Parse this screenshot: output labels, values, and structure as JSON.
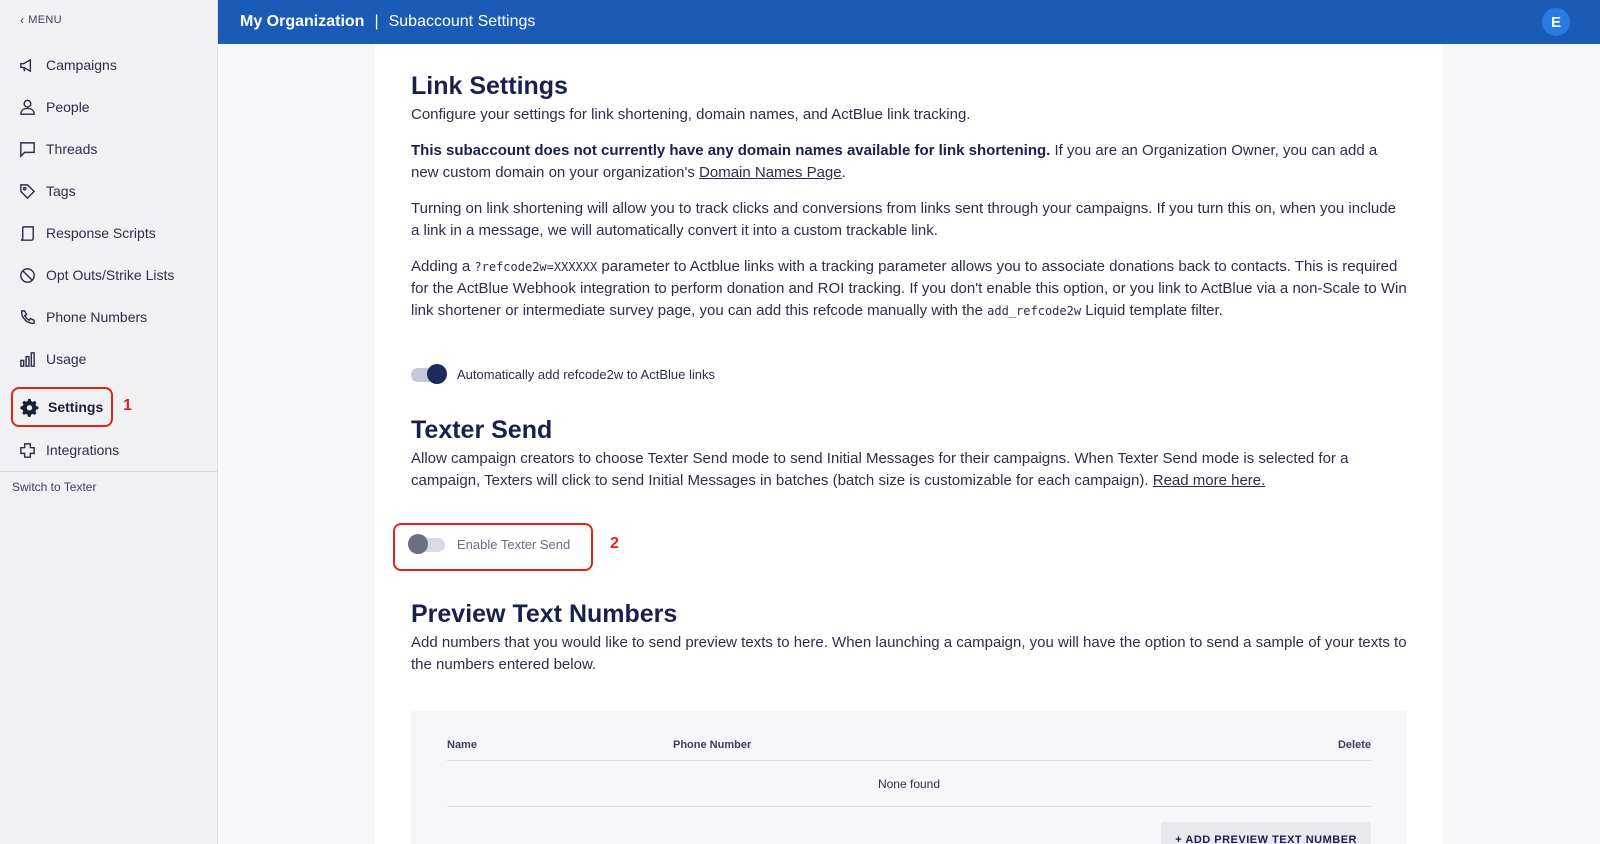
{
  "sidebar": {
    "menu_back": "MENU",
    "items": [
      {
        "label": "Campaigns",
        "icon": "megaphone-icon"
      },
      {
        "label": "People",
        "icon": "person-icon"
      },
      {
        "label": "Threads",
        "icon": "chat-icon"
      },
      {
        "label": "Tags",
        "icon": "tag-icon"
      },
      {
        "label": "Response Scripts",
        "icon": "script-icon"
      },
      {
        "label": "Opt Outs/Strike Lists",
        "icon": "block-icon"
      },
      {
        "label": "Phone Numbers",
        "icon": "phone-icon"
      },
      {
        "label": "Usage",
        "icon": "bar-chart-icon"
      },
      {
        "label": "Settings",
        "icon": "gear-icon",
        "active": true
      },
      {
        "label": "Integrations",
        "icon": "puzzle-icon"
      }
    ],
    "switch_to_texter": "Switch to Texter"
  },
  "annotations": {
    "marker_1": "1",
    "marker_2": "2",
    "color": "#e0241b"
  },
  "header": {
    "org": "My Organization",
    "separator": "|",
    "page": "Subaccount Settings",
    "avatar_initial": "E",
    "bg_color": "#1b5bb8"
  },
  "link_settings": {
    "title": "Link Settings",
    "intro": "Configure your settings for link shortening, domain names, and ActBlue link tracking.",
    "no_domain_bold": "This subaccount does not currently have any domain names available for link shortening.",
    "no_domain_rest": " If you are an Organization Owner, you can add a new custom domain on your organization's ",
    "domain_link": "Domain Names Page",
    "domain_period": ".",
    "shortening_text": "Turning on link shortening will allow you to track clicks and conversions from links sent through your campaigns. If you turn this on, when you include a link in a message, we will automatically convert it into a custom trackable link.",
    "refcode_pre": "Adding a ",
    "refcode_code": "?refcode2w=XXXXXX",
    "refcode_mid": " parameter to Actblue links with a tracking parameter allows you to associate donations back to contacts. This is required for the ActBlue Webhook integration to perform donation and ROI tracking. If you don't enable this option, or you link to ActBlue via a non-Scale to Win link shortener or intermediate survey page, you can add this refcode manually with the ",
    "refcode_filter": "add_refcode2w",
    "refcode_post": " Liquid template filter.",
    "toggle_label": "Automatically add refcode2w to ActBlue links",
    "toggle_on": true
  },
  "texter_send": {
    "title": "Texter Send",
    "desc": "Allow campaign creators to choose Texter Send mode to send Initial Messages for their campaigns. When Texter Send mode is selected for a campaign, Texters will click to send Initial Messages in batches (batch size is customizable for each campaign). ",
    "read_more": "Read more here.",
    "toggle_label": "Enable Texter Send",
    "toggle_on": false
  },
  "preview_numbers": {
    "title": "Preview Text Numbers",
    "desc": "Add numbers that you would like to send preview texts to here. When launching a campaign, you will have the option to send a sample of your texts to the numbers entered below.",
    "columns": [
      "Name",
      "Phone Number",
      "Delete"
    ],
    "empty": "None found",
    "add_button": "+ ADD PREVIEW TEXT NUMBER"
  }
}
